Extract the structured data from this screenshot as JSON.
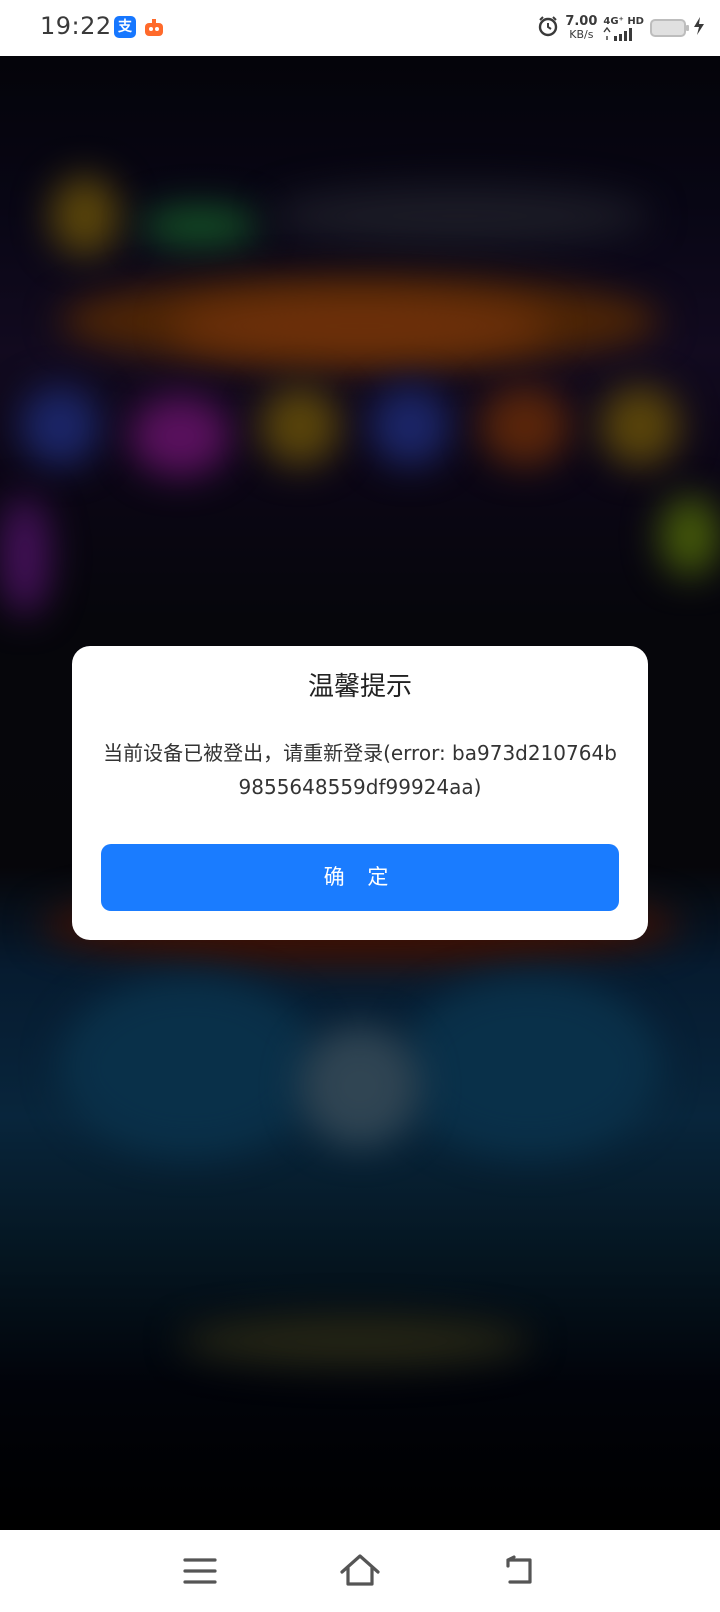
{
  "status_bar": {
    "time": "19:22",
    "alipay_icon_text": "支",
    "net_speed": "7.00",
    "net_speed_unit": "KB/s",
    "network": "4G⁺ HD",
    "icons": [
      "alipay-icon",
      "notification-app-icon",
      "alarm-icon",
      "signal-icon",
      "battery-icon",
      "charging-icon"
    ]
  },
  "dialog": {
    "title": "温馨提示",
    "message": "当前设备已被登出，请重新登录(error: ba973d210764b9855648559df99924aa)",
    "confirm_label": "确 定",
    "confirm_color": "#1a7cff"
  },
  "nav_bar": {
    "icons": [
      "menu-icon",
      "home-icon",
      "back-icon"
    ]
  }
}
